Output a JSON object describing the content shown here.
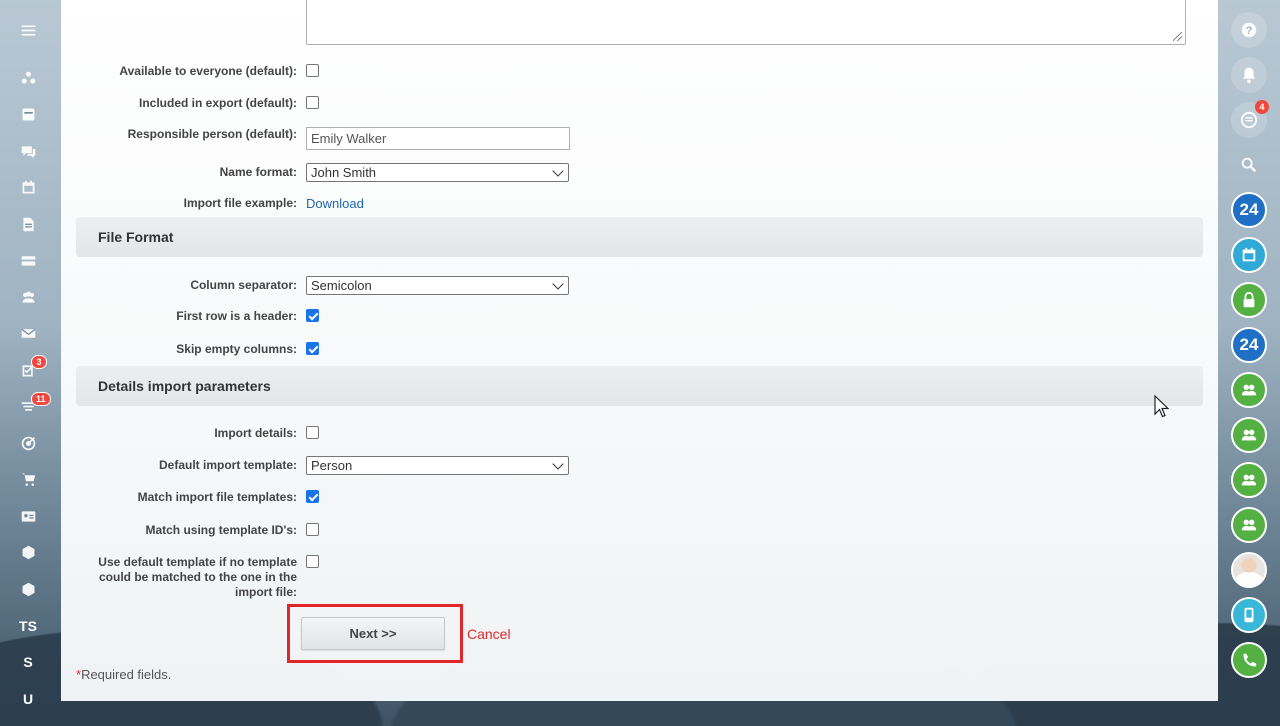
{
  "left_menu": {
    "items": [
      {
        "icon": "menu-icon"
      },
      {
        "icon": "activity-stream-icon"
      },
      {
        "icon": "feed-icon"
      },
      {
        "icon": "chat-icon"
      },
      {
        "icon": "calendar-icon"
      },
      {
        "icon": "document-icon"
      },
      {
        "icon": "drive-icon"
      },
      {
        "icon": "groups-icon"
      },
      {
        "icon": "mail-icon"
      },
      {
        "icon": "tasks-icon",
        "badge": "3"
      },
      {
        "icon": "crm-icon",
        "badge": "11"
      },
      {
        "icon": "marketing-icon"
      },
      {
        "icon": "shop-icon"
      },
      {
        "icon": "contact-card-icon"
      },
      {
        "icon": "box-icon"
      },
      {
        "icon": "box-icon"
      },
      {
        "text": "TS"
      },
      {
        "text": "S"
      },
      {
        "text": "U"
      }
    ]
  },
  "form": {
    "available_label": "Available to everyone (default):",
    "available_checked": false,
    "export_label": "Included in export (default):",
    "export_checked": false,
    "responsible_label": "Responsible person (default):",
    "responsible_value": "Emily Walker",
    "name_format_label": "Name format:",
    "name_format_value": "John Smith",
    "import_example_label": "Import file example:",
    "import_example_link": "Download"
  },
  "file_format": {
    "title": "File Format",
    "separator_label": "Column separator:",
    "separator_value": "Semicolon",
    "header_label": "First row is a header:",
    "header_checked": true,
    "skip_label": "Skip empty columns:",
    "skip_checked": true
  },
  "details": {
    "title": "Details import parameters",
    "import_details_label": "Import details:",
    "import_details_checked": false,
    "default_template_label": "Default import template:",
    "default_template_value": "Person",
    "match_templates_label": "Match import file templates:",
    "match_templates_checked": true,
    "match_ids_label": "Match using template ID's:",
    "match_ids_checked": false,
    "use_default_label_line1": "Use default template if no template",
    "use_default_label_line2": "could be matched to the one in the",
    "use_default_label_line3": "import file:",
    "use_default_checked": false
  },
  "actions": {
    "next_label": "Next >>",
    "cancel_label": "Cancel",
    "required_star": "*",
    "required_text": "Required fields."
  },
  "right_bar": {
    "items": [
      {
        "icon": "help-icon"
      },
      {
        "icon": "bell-icon"
      },
      {
        "icon": "open-channels-icon",
        "badge": "4"
      },
      {
        "icon": "search-icon"
      },
      {
        "icon": "bitrix24-icon",
        "text": "24"
      },
      {
        "icon": "calendar-icon"
      },
      {
        "icon": "lock-icon"
      },
      {
        "icon": "bitrix24-icon",
        "text": "24"
      },
      {
        "icon": "group-chat-icon"
      },
      {
        "icon": "group-chat-icon"
      },
      {
        "icon": "group-chat-icon"
      },
      {
        "icon": "group-chat-icon"
      },
      {
        "icon": "user-avatar"
      },
      {
        "icon": "mobile-icon"
      },
      {
        "icon": "phone-icon"
      }
    ]
  }
}
